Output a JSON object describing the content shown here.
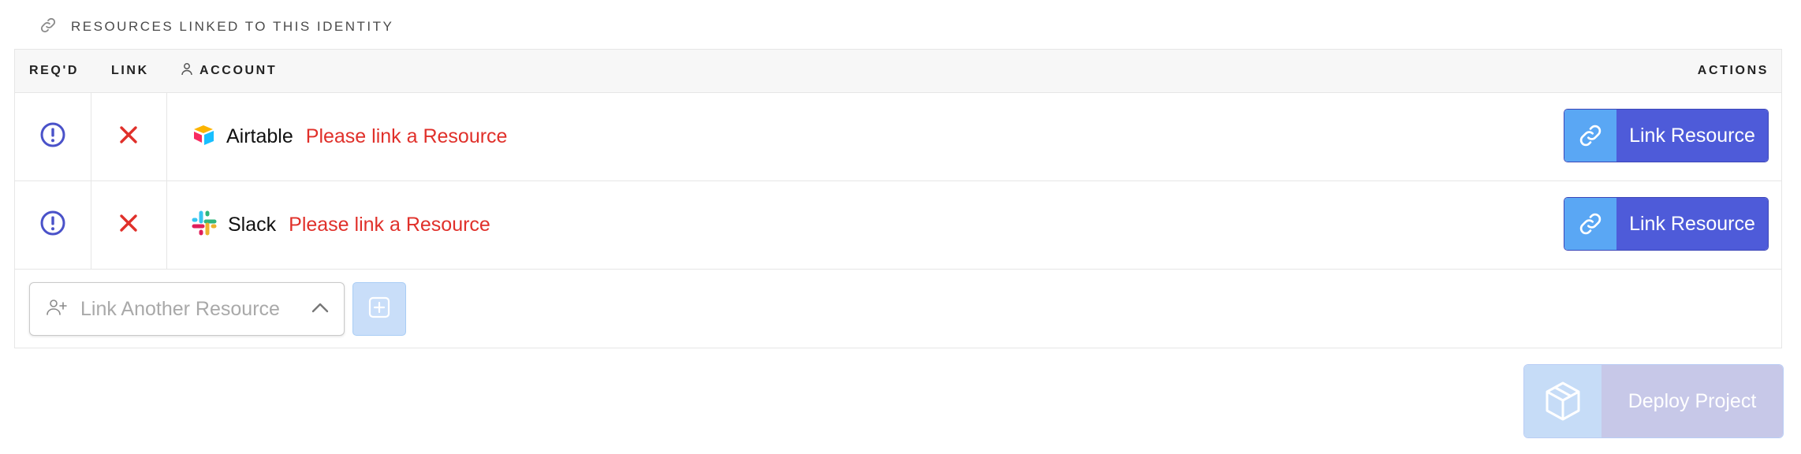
{
  "section": {
    "title": "RESOURCES LINKED TO THIS IDENTITY",
    "icon": "link-icon"
  },
  "table": {
    "columns": {
      "required": "REQ'D",
      "link": "LINK",
      "account": "ACCOUNT",
      "actions": "ACTIONS"
    },
    "rows": [
      {
        "name": "Airtable",
        "status": "Please link a Resource",
        "required_icon": "exclamation-circle-icon",
        "link_icon": "x-icon",
        "logo": "airtable-logo",
        "action_label": "Link Resource"
      },
      {
        "name": "Slack",
        "status": "Please link a Resource",
        "required_icon": "exclamation-circle-icon",
        "link_icon": "x-icon",
        "logo": "slack-logo",
        "action_label": "Link Resource"
      }
    ]
  },
  "link_another": {
    "placeholder": "Link Another Resource"
  },
  "deploy": {
    "label": "Deploy Project"
  },
  "colors": {
    "accent": "#4e5bd9",
    "accent_light": "#5aa7f4",
    "error": "#e0302a",
    "required": "#4a52c9"
  }
}
